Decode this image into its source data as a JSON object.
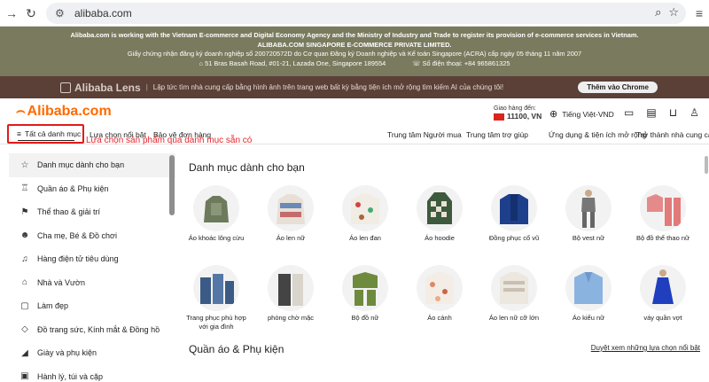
{
  "browser": {
    "url": "alibaba.com"
  },
  "notice": {
    "line1": "Alibaba.com is working with the Vietnam E-commerce and Digital Economy Agency and the Ministry of Industry and Trade to register its provision of e-commerce services in Vietnam.",
    "line2": "ALIBABA.COM SINGAPORE E-COMMERCE PRIVATE LIMITED.",
    "line3": "Giấy chứng nhận đăng ký doanh nghiệp số 200720572D do Cơ quan Đăng ký Doanh nghiệp và Kế toán Singapore (ACRA) cấp ngày 05 tháng 11 năm 2007",
    "address": "51 Bras Basah Road, #01-21, Lazada One, Singapore 189554",
    "phone": "Số điện thoại: +84 965861325"
  },
  "lens": {
    "name": "Alibaba Lens",
    "text": "Lập tức tìm nhà cung cấp bằng hình ảnh trên trang web bất kỳ bằng tiện ích mở rộng tìm kiếm AI của chúng tôi!",
    "button": "Thêm vào Chrome"
  },
  "header": {
    "brand": "Alibaba.com",
    "deliver_label": "Giao hàng đến:",
    "deliver_zip": "11100, VN",
    "language": "Tiếng Việt-VND"
  },
  "nav": {
    "all_categories": "Tất cả danh mục",
    "featured": "Lựa chọn nổi bật",
    "protection": "Bảo vệ đơn hàng",
    "buyer_center": "Trung tâm Người mua",
    "help_center": "Trung tâm trợ giúp",
    "apps": "Ứng dụng & tiện ích mở rộng",
    "become_supplier": "Trở thành nhà cung cấp"
  },
  "annotation": "Lựa chọn sản phẩm qua danh mục sẵn có",
  "sidebar": {
    "items": [
      {
        "label": "Danh mục dành cho bạn",
        "icon": "star-icon"
      },
      {
        "label": "Quần áo & Phụ kiện",
        "icon": "dress-icon"
      },
      {
        "label": "Thể thao & giải trí",
        "icon": "sports-icon"
      },
      {
        "label": "Cha mẹ, Bé & Đồ chơi",
        "icon": "bear-icon"
      },
      {
        "label": "Hàng điện tử tiêu dùng",
        "icon": "headphones-icon"
      },
      {
        "label": "Nhà và Vườn",
        "icon": "home-icon"
      },
      {
        "label": "Làm đẹp",
        "icon": "beauty-icon"
      },
      {
        "label": "Đồ trang sức, Kính mắt & Đồng hồ",
        "icon": "diamond-icon"
      },
      {
        "label": "Giày và phụ kiện",
        "icon": "shoe-icon"
      },
      {
        "label": "Hành lý, túi và cặp",
        "icon": "bag-icon"
      }
    ]
  },
  "main": {
    "section1_title": "Danh mục dành cho bạn",
    "section2_title": "Quần áo & Phụ kiện",
    "section2_link": "Duyệt xem những lựa chọn nổi bật",
    "row1": [
      {
        "label": "Áo khoác lông cừu"
      },
      {
        "label": "Áo len nữ"
      },
      {
        "label": "Áo len đan"
      },
      {
        "label": "Áo hoodie"
      },
      {
        "label": "Đồng phục cổ vũ"
      },
      {
        "label": "Bộ vest nữ"
      },
      {
        "label": "Bộ đồ thể thao nữ"
      }
    ],
    "row2": [
      {
        "label": "Trang phục phù hợp với gia đình"
      },
      {
        "label": "phòng chờ mặc"
      },
      {
        "label": "Bộ đồ nữ"
      },
      {
        "label": "Áo cánh"
      },
      {
        "label": "Áo len nữ cỡ lớn"
      },
      {
        "label": "Áo kiểu nữ"
      },
      {
        "label": "váy quần vợt"
      }
    ]
  },
  "colors": {
    "brand": "#ff6a00",
    "notice_bg": "#7a7a5e",
    "lens_bg": "#5a4037",
    "annotation": "#e8262a"
  }
}
